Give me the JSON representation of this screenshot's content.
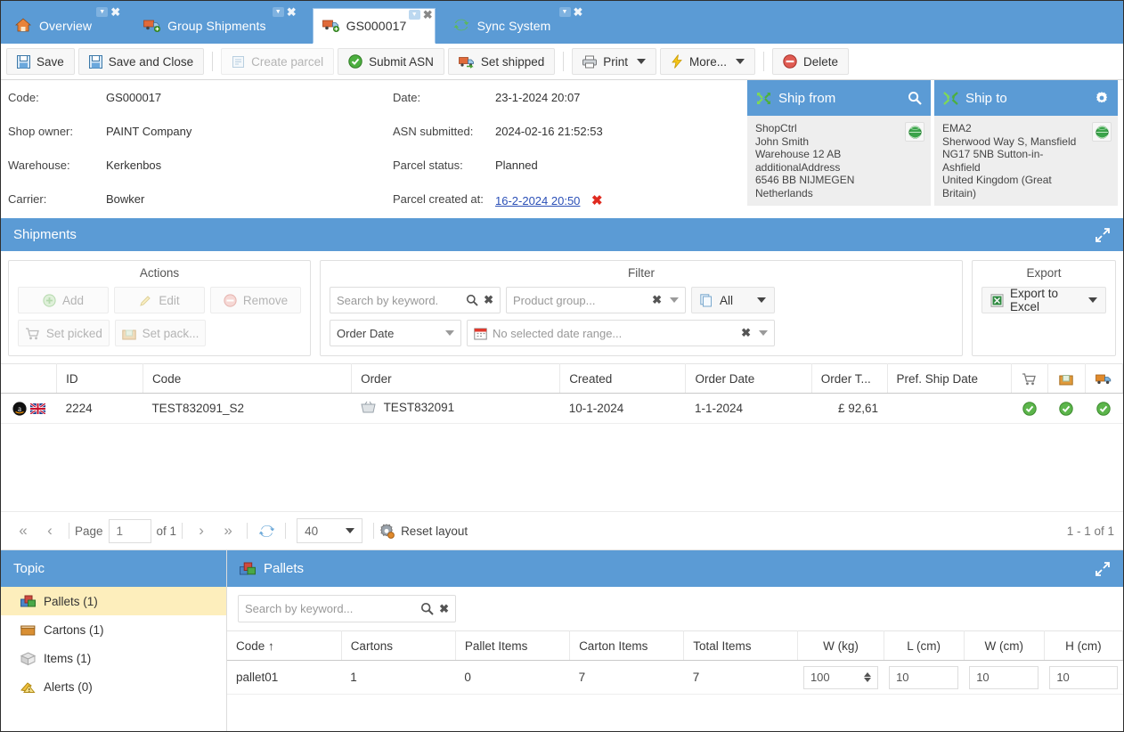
{
  "tabs": [
    {
      "label": "Overview",
      "icon": "home-icon",
      "active": false
    },
    {
      "label": "Group Shipments",
      "icon": "truck-add-icon",
      "active": false
    },
    {
      "label": "GS000017",
      "icon": "truck-add-icon",
      "active": true
    },
    {
      "label": "Sync System",
      "icon": "sync-icon",
      "active": false
    }
  ],
  "toolbar": {
    "save": "Save",
    "save_and_close": "Save and Close",
    "create_parcel": "Create parcel",
    "submit_asn": "Submit ASN",
    "set_shipped": "Set shipped",
    "print": "Print",
    "more": "More...",
    "delete": "Delete"
  },
  "details": {
    "left": [
      {
        "label": "Code:",
        "value": "GS000017"
      },
      {
        "label": "Shop owner:",
        "value": "PAINT Company"
      },
      {
        "label": "Warehouse:",
        "value": "Kerkenbos"
      },
      {
        "label": "Carrier:",
        "value": "Bowker"
      }
    ],
    "right": [
      {
        "label": "Date:",
        "value": "23-1-2024 20:07"
      },
      {
        "label": "ASN submitted:",
        "value": "2024-02-16 21:52:53"
      },
      {
        "label": "Parcel status:",
        "value": "Planned"
      },
      {
        "label": "Parcel created at:",
        "value": "16-2-2024 20:50"
      }
    ]
  },
  "ship_from": {
    "title": "Ship from",
    "action_icon": "search-icon",
    "lines": [
      "ShopCtrl",
      "John Smith",
      "Warehouse 12 AB",
      "additionalAddress",
      "6546 BB NIJMEGEN",
      "Netherlands"
    ]
  },
  "ship_to": {
    "title": "Ship to",
    "action_icon": "gear-icon",
    "lines": [
      "EMA2",
      "Sherwood Way S, Mansfield",
      "NG17 5NB Sutton-in-",
      "Ashfield",
      "United Kingdom (Great",
      "Britain)"
    ]
  },
  "shipments": {
    "title": "Shipments",
    "actions": {
      "title": "Actions",
      "add": "Add",
      "edit": "Edit",
      "remove": "Remove",
      "set_picked": "Set picked",
      "set_packed": "Set pack..."
    },
    "filter": {
      "title": "Filter",
      "keyword_placeholder": "Search by keyword.",
      "product_group_placeholder": "Product group...",
      "all_label": "All",
      "order_date_label": "Order Date",
      "date_range_placeholder": "No selected date range..."
    },
    "export": {
      "title": "Export",
      "excel": "Export to Excel"
    },
    "columns": [
      "",
      "ID",
      "Code",
      "Order",
      "Created",
      "Order Date",
      "Order T...",
      "Pref. Ship Date",
      "cart-icon",
      "package-icon",
      "truck-icon"
    ],
    "rows": [
      {
        "flags": [
          "amazon-icon",
          "uk-flag-icon"
        ],
        "id": "2224",
        "code": "TEST832091_S2",
        "order": "TEST832091",
        "created": "10-1-2024",
        "order_date": "1-1-2024",
        "order_total": "£ 92,61",
        "pref_ship_date": "",
        "picked": "check-green-icon",
        "packed": "check-green-icon",
        "shipped": "check-green-icon"
      }
    ],
    "pager": {
      "page_label": "Page",
      "page_value": "1",
      "of_label": "of 1",
      "page_size": "40",
      "reset_layout": "Reset layout",
      "range": "1 - 1 of 1"
    }
  },
  "topic": {
    "title": "Topic",
    "items": [
      {
        "label": "Pallets (1)",
        "icon": "pallets-icon",
        "selected": true
      },
      {
        "label": "Cartons (1)",
        "icon": "carton-icon",
        "selected": false
      },
      {
        "label": "Items (1)",
        "icon": "items-icon",
        "selected": false
      },
      {
        "label": "Alerts (0)",
        "icon": "alert-icon",
        "selected": false
      }
    ]
  },
  "pallets": {
    "title": "Pallets",
    "search_placeholder": "Search by keyword...",
    "columns": [
      "Code ↑",
      "Cartons",
      "Pallet Items",
      "Carton Items",
      "Total Items",
      "W (kg)",
      "L (cm)",
      "W (cm)",
      "H (cm)"
    ],
    "rows": [
      {
        "code": "pallet01",
        "cartons": "1",
        "pallet_items": "0",
        "carton_items": "7",
        "total_items": "7",
        "w_kg": "100",
        "l_cm": "10",
        "w_cm": "10",
        "h_cm": "10"
      }
    ]
  },
  "colors": {
    "header_blue": "#5b9bd5",
    "selected_row": "#fdeebc",
    "link": "#2a4fb7",
    "danger": "#e02b20"
  }
}
